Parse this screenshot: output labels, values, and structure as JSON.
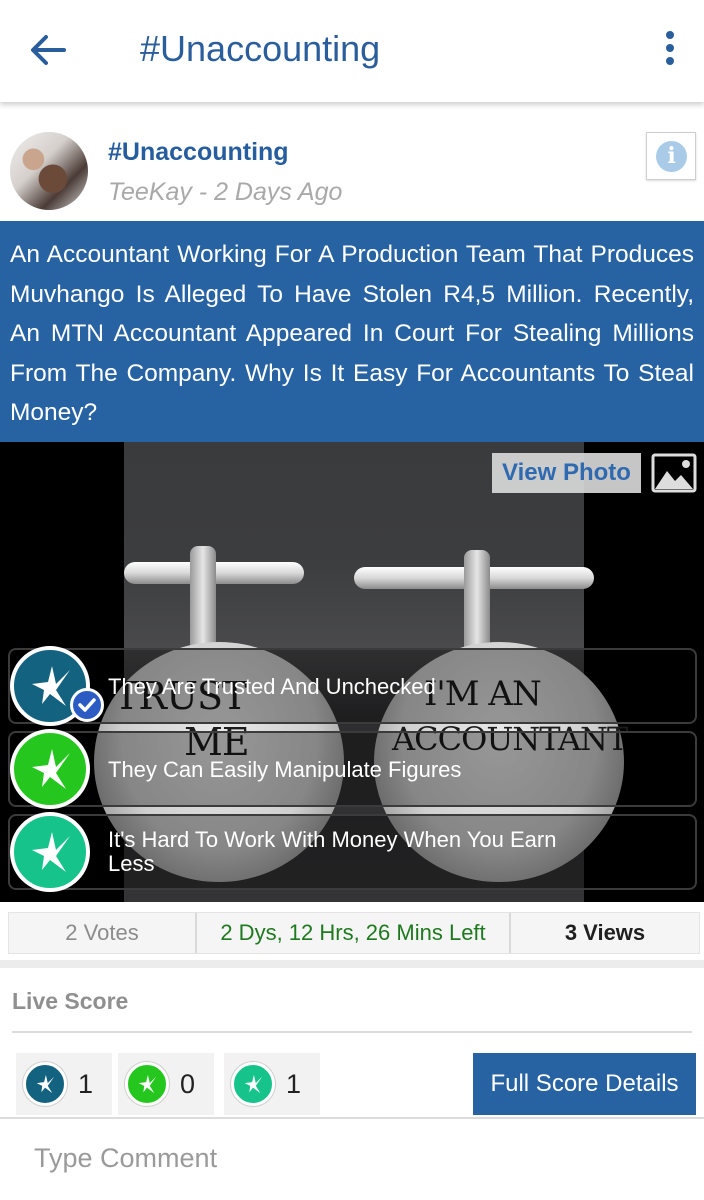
{
  "appbar": {
    "title": "#Unaccounting",
    "back_icon": "arrow-left-icon",
    "menu_icon": "more-vertical-icon"
  },
  "post": {
    "title": "#Unaccounting",
    "meta": "TeeKay - 2 Days Ago",
    "info_icon": "info-icon",
    "question": "An Accountant Working For A Production Team That Produces Muvhango Is Alleged To Have Stolen R4,5 Million. Recently, An MTN Accountant Appeared In Court For Stealing Millions From The Company. Why Is It Easy For Accountants To Steal Money?"
  },
  "photo": {
    "view_photo_label": "View Photo",
    "gallery_icon": "image-icon",
    "cufflink_left": [
      "TRUST",
      "ME"
    ],
    "cufflink_right": [
      "I'M AN",
      "ACCOUNTANT"
    ]
  },
  "options": [
    {
      "label": "They Are Trusted And Unchecked",
      "color": "#13627f",
      "selected": true
    },
    {
      "label": "They Can Easily Manipulate Figures",
      "color": "#25c71f",
      "selected": false
    },
    {
      "label": "It's Hard To Work With Money When You Earn Less",
      "color": "#16c48b",
      "selected": false
    }
  ],
  "stats": {
    "votes": "2 Votes",
    "time_left": "2 Dys, 12 Hrs, 26 Mins Left",
    "views": "3 Views"
  },
  "live_score": {
    "title": "Live Score",
    "scores": [
      {
        "count": "1",
        "color": "#13627f"
      },
      {
        "count": "0",
        "color": "#25c71f"
      },
      {
        "count": "1",
        "color": "#16c48b"
      }
    ],
    "full_details_label": "Full Score Details"
  },
  "comment": {
    "placeholder": "Type Comment",
    "value": ""
  },
  "colors": {
    "brand_blue": "#2762a3",
    "time_green": "#1f7a1f"
  }
}
